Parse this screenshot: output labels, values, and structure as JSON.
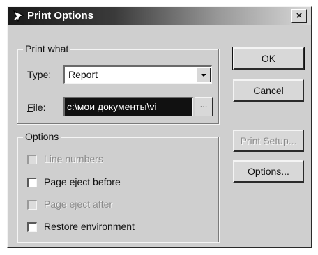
{
  "window": {
    "title": "Print Options",
    "close_label": "×"
  },
  "print_what": {
    "group_label": "Print what",
    "type_label": "Type:",
    "type_value": "Report",
    "file_label": "File:",
    "file_value": "c:\\мои документы\\vi",
    "browse_label": "..."
  },
  "options": {
    "group_label": "Options",
    "items": [
      {
        "label": "Line numbers",
        "checked": false,
        "enabled": false
      },
      {
        "label": "Page eject before",
        "checked": false,
        "enabled": true
      },
      {
        "label": "Page eject after",
        "checked": false,
        "enabled": false
      },
      {
        "label": "Restore environment",
        "checked": false,
        "enabled": true
      }
    ]
  },
  "buttons": {
    "ok": "OK",
    "cancel": "Cancel",
    "print_setup": "Print Setup...",
    "options": "Options..."
  },
  "icons": {
    "title": "cursor-arrow-icon",
    "dropdown": "chevron-down-icon"
  }
}
